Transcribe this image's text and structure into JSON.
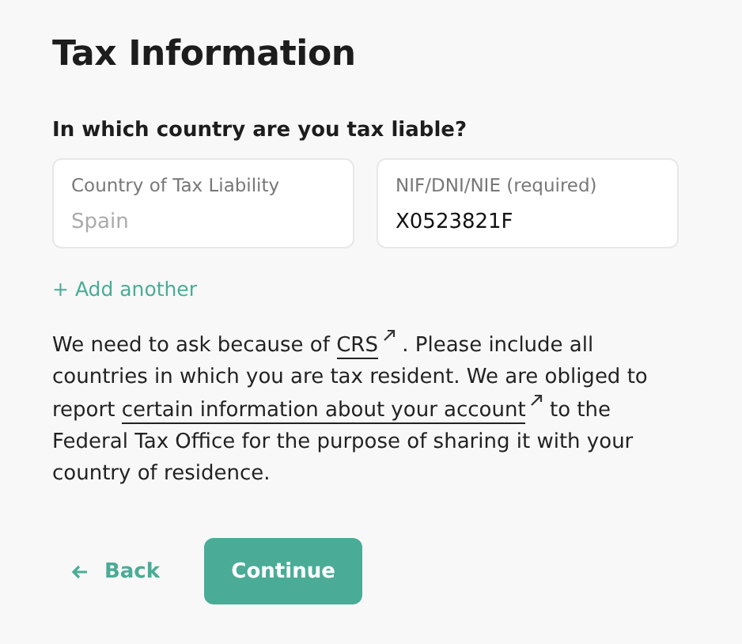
{
  "title": "Tax Information",
  "question": "In which country are you tax liable?",
  "fields": [
    {
      "label": "Country of Tax Liability",
      "value": "Spain",
      "disabled": true
    },
    {
      "label": "NIF/DNI/NIE (required)",
      "value": "X0523821F",
      "disabled": false
    }
  ],
  "add_link": "+ Add another",
  "explanation": [
    {
      "kind": "text",
      "text": "We need to ask because of "
    },
    {
      "kind": "link",
      "text": "CRS",
      "external": true
    },
    {
      "kind": "text",
      "text": " . Please include all countries in which you are tax resident. We are obliged to report "
    },
    {
      "kind": "link",
      "text": "certain information about your account",
      "external": true
    },
    {
      "kind": "text",
      "text": "  to the Federal Tax Office for the purpose of sharing it with your country of residence."
    }
  ],
  "buttons": [
    {
      "kind": "back",
      "label": "Back"
    },
    {
      "kind": "primary",
      "label": "Continue"
    }
  ]
}
